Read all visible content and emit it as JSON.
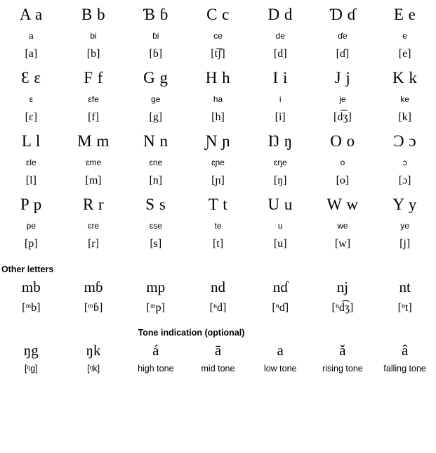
{
  "alphabet": {
    "rows": [
      [
        {
          "pair": "A a",
          "name": "a",
          "ipa": "[a]"
        },
        {
          "pair": "B b",
          "name": "bi",
          "ipa": "[b]"
        },
        {
          "pair": "Ɓ ɓ",
          "name": "ɓi",
          "ipa": "[ɓ]"
        },
        {
          "pair": "C c",
          "name": "ce",
          "ipa": "[t͡ʃ]"
        },
        {
          "pair": "D d",
          "name": "de",
          "ipa": "[d]"
        },
        {
          "pair": "Ɗ ɗ",
          "name": "ɗe",
          "ipa": "[ɗ]"
        },
        {
          "pair": "E e",
          "name": "e",
          "ipa": "[e]"
        }
      ],
      [
        {
          "pair": "Ɛ ɛ",
          "name": "ɛ",
          "ipa": "[ɛ]"
        },
        {
          "pair": "F f",
          "name": "ɛfe",
          "ipa": "[f]"
        },
        {
          "pair": "G g",
          "name": "ge",
          "ipa": "[g]"
        },
        {
          "pair": "H h",
          "name": "ha",
          "ipa": "[h]"
        },
        {
          "pair": "I i",
          "name": "i",
          "ipa": "[i]"
        },
        {
          "pair": "J j",
          "name": "je",
          "ipa": "[d͡ʒ]"
        },
        {
          "pair": "K k",
          "name": "ke",
          "ipa": "[k]"
        }
      ],
      [
        {
          "pair": "L l",
          "name": "ɛle",
          "ipa": "[l]"
        },
        {
          "pair": "M m",
          "name": "ɛme",
          "ipa": "[m]"
        },
        {
          "pair": "N n",
          "name": "ɛne",
          "ipa": "[n]"
        },
        {
          "pair": "Ɲ ɲ",
          "name": "ɛɲe",
          "ipa": "[ɲ]"
        },
        {
          "pair": "Ŋ ŋ",
          "name": "ɛŋe",
          "ipa": "[ŋ]"
        },
        {
          "pair": "O o",
          "name": "o",
          "ipa": "[o]"
        },
        {
          "pair": "Ɔ ɔ",
          "name": "ɔ",
          "ipa": "[ɔ]"
        }
      ],
      [
        {
          "pair": "P p",
          "name": "pe",
          "ipa": "[p]"
        },
        {
          "pair": "R r",
          "name": "ɛre",
          "ipa": "[r]"
        },
        {
          "pair": "S s",
          "name": "ɛse",
          "ipa": "[s]"
        },
        {
          "pair": "T t",
          "name": "te",
          "ipa": "[t]"
        },
        {
          "pair": "U u",
          "name": "u",
          "ipa": "[u]"
        },
        {
          "pair": "W w",
          "name": "we",
          "ipa": "[w]"
        },
        {
          "pair": "Y y",
          "name": "ye",
          "ipa": "[j]"
        }
      ]
    ]
  },
  "other_letters": {
    "heading": "Other letters",
    "rows": [
      [
        {
          "form": "mb",
          "ipa": "[ᵐb]"
        },
        {
          "form": "mɓ",
          "ipa": "[ᵐɓ]"
        },
        {
          "form": "mp",
          "ipa": "[ᵐp]"
        },
        {
          "form": "nd",
          "ipa": "[ⁿd]"
        },
        {
          "form": "nɗ",
          "ipa": "[ⁿɗ]"
        },
        {
          "form": "nj",
          "ipa": "[ⁿd͡ʒ]"
        },
        {
          "form": "nt",
          "ipa": "[ⁿt]"
        }
      ]
    ]
  },
  "tone": {
    "heading": "Tone indication (optional)",
    "items": [
      {
        "form": "ŋg",
        "label": "[ᵑg]"
      },
      {
        "form": "ŋk",
        "label": "[ᵑk]"
      },
      {
        "form": "á",
        "label": "high tone"
      },
      {
        "form": "ā",
        "label": "mid tone"
      },
      {
        "form": "a",
        "label": "low tone"
      },
      {
        "form": "ǎ",
        "label": "rising tone"
      },
      {
        "form": "â",
        "label": "falling tone"
      }
    ]
  }
}
